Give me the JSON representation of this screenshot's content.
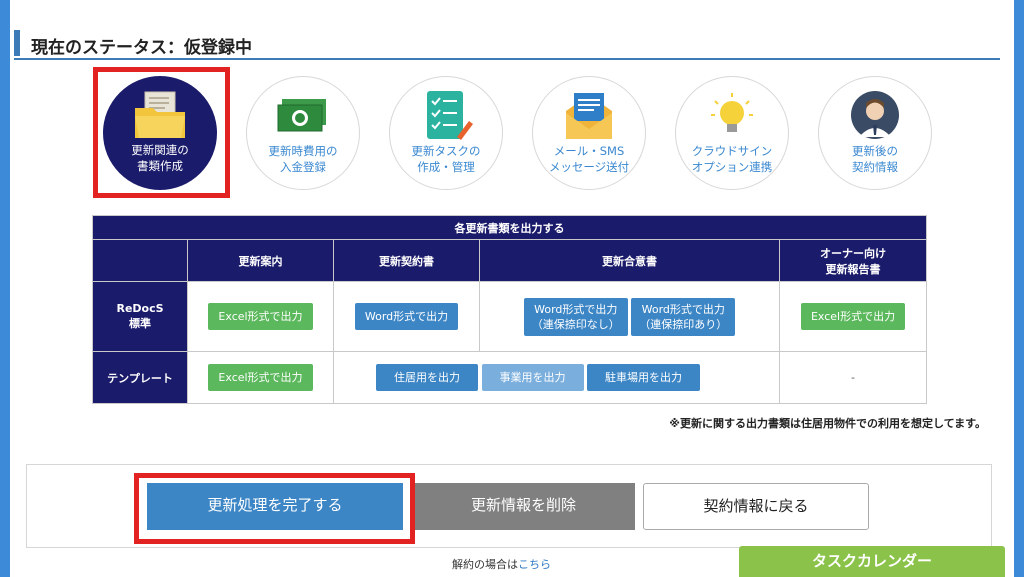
{
  "status": {
    "title": "現在のステータス：仮登録中"
  },
  "steps": [
    {
      "line1": "更新関連の",
      "line2": "書類作成",
      "icon": "folder-documents-icon"
    },
    {
      "line1": "更新時費用の",
      "line2": "入金登録",
      "icon": "money-icon"
    },
    {
      "line1": "更新タスクの",
      "line2": "作成・管理",
      "icon": "checklist-icon"
    },
    {
      "line1": "メール・SMS",
      "line2": "メッセージ送付",
      "icon": "envelope-icon"
    },
    {
      "line1": "クラウドサイン",
      "line2": "オプション連携",
      "icon": "lightbulb-icon"
    },
    {
      "line1": "更新後の",
      "line2": "契約情報",
      "icon": "person-icon"
    }
  ],
  "table": {
    "caption": "各更新書類を出力する",
    "headers": [
      "更新案内",
      "更新契約書",
      "更新合意書",
      "オーナー向け",
      "更新報告書"
    ],
    "rows": {
      "redocs_label1": "ReDocS",
      "redocs_label2": "標準",
      "template_label": "テンプレート"
    },
    "buttons": {
      "excel": "Excel形式で出力",
      "word": "Word形式で出力",
      "word_no_seal_1": "Word形式で出力",
      "word_no_seal_2": "（連保捺印なし）",
      "word_seal_1": "Word形式で出力",
      "word_seal_2": "（連保捺印あり）",
      "residential": "住居用を出力",
      "business": "事業用を出力",
      "parking": "駐車場用を出力",
      "dash": "-"
    }
  },
  "note": "※更新に関する出力書類は住居用物件での利用を想定してます。",
  "actions": {
    "complete": "更新処理を完了する",
    "delete": "更新情報を削除",
    "back": "契約情報に戻る"
  },
  "footer": {
    "cancel_prefix": "解約の場合は",
    "cancel_link": "こちら",
    "task_tab": "タスクカレンダー"
  },
  "colors": {
    "navy": "#1b1b6b",
    "blue": "#3d86c6",
    "green": "#5cb85c",
    "red": "#e32222",
    "task_green": "#8bc34a"
  }
}
